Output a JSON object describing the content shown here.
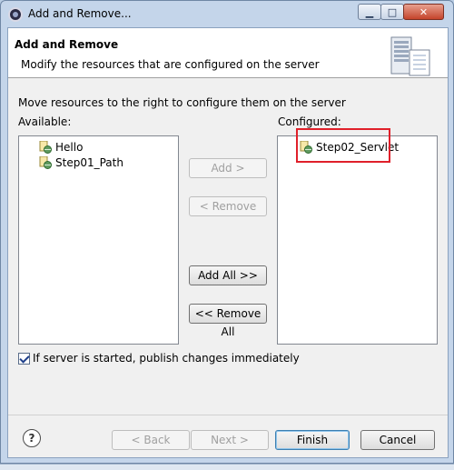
{
  "window": {
    "title": "Add and Remove..."
  },
  "banner": {
    "title": "Add and Remove",
    "description": "Modify the resources that are configured on the server"
  },
  "instruction": "Move resources to the right to configure them on the server",
  "available": {
    "label": "Available:",
    "items": [
      {
        "label": "Hello",
        "icon": "web-module-icon"
      },
      {
        "label": "Step01_Path",
        "icon": "web-module-icon"
      }
    ]
  },
  "configured": {
    "label": "Configured:",
    "items": [
      {
        "label": "Step02_Servlet",
        "icon": "web-module-icon"
      }
    ]
  },
  "buttons": {
    "add": "Add >",
    "remove": "< Remove",
    "add_all": "Add All >>",
    "remove_all": "<< Remove All"
  },
  "publish_checkbox": {
    "label": "If server is started, publish changes immediately",
    "checked": true
  },
  "footer": {
    "help": "?",
    "back": "< Back",
    "next": "Next >",
    "finish": "Finish",
    "cancel": "Cancel"
  },
  "colors": {
    "highlight": "#e0202a",
    "window_frame": "#c4d5ea"
  }
}
